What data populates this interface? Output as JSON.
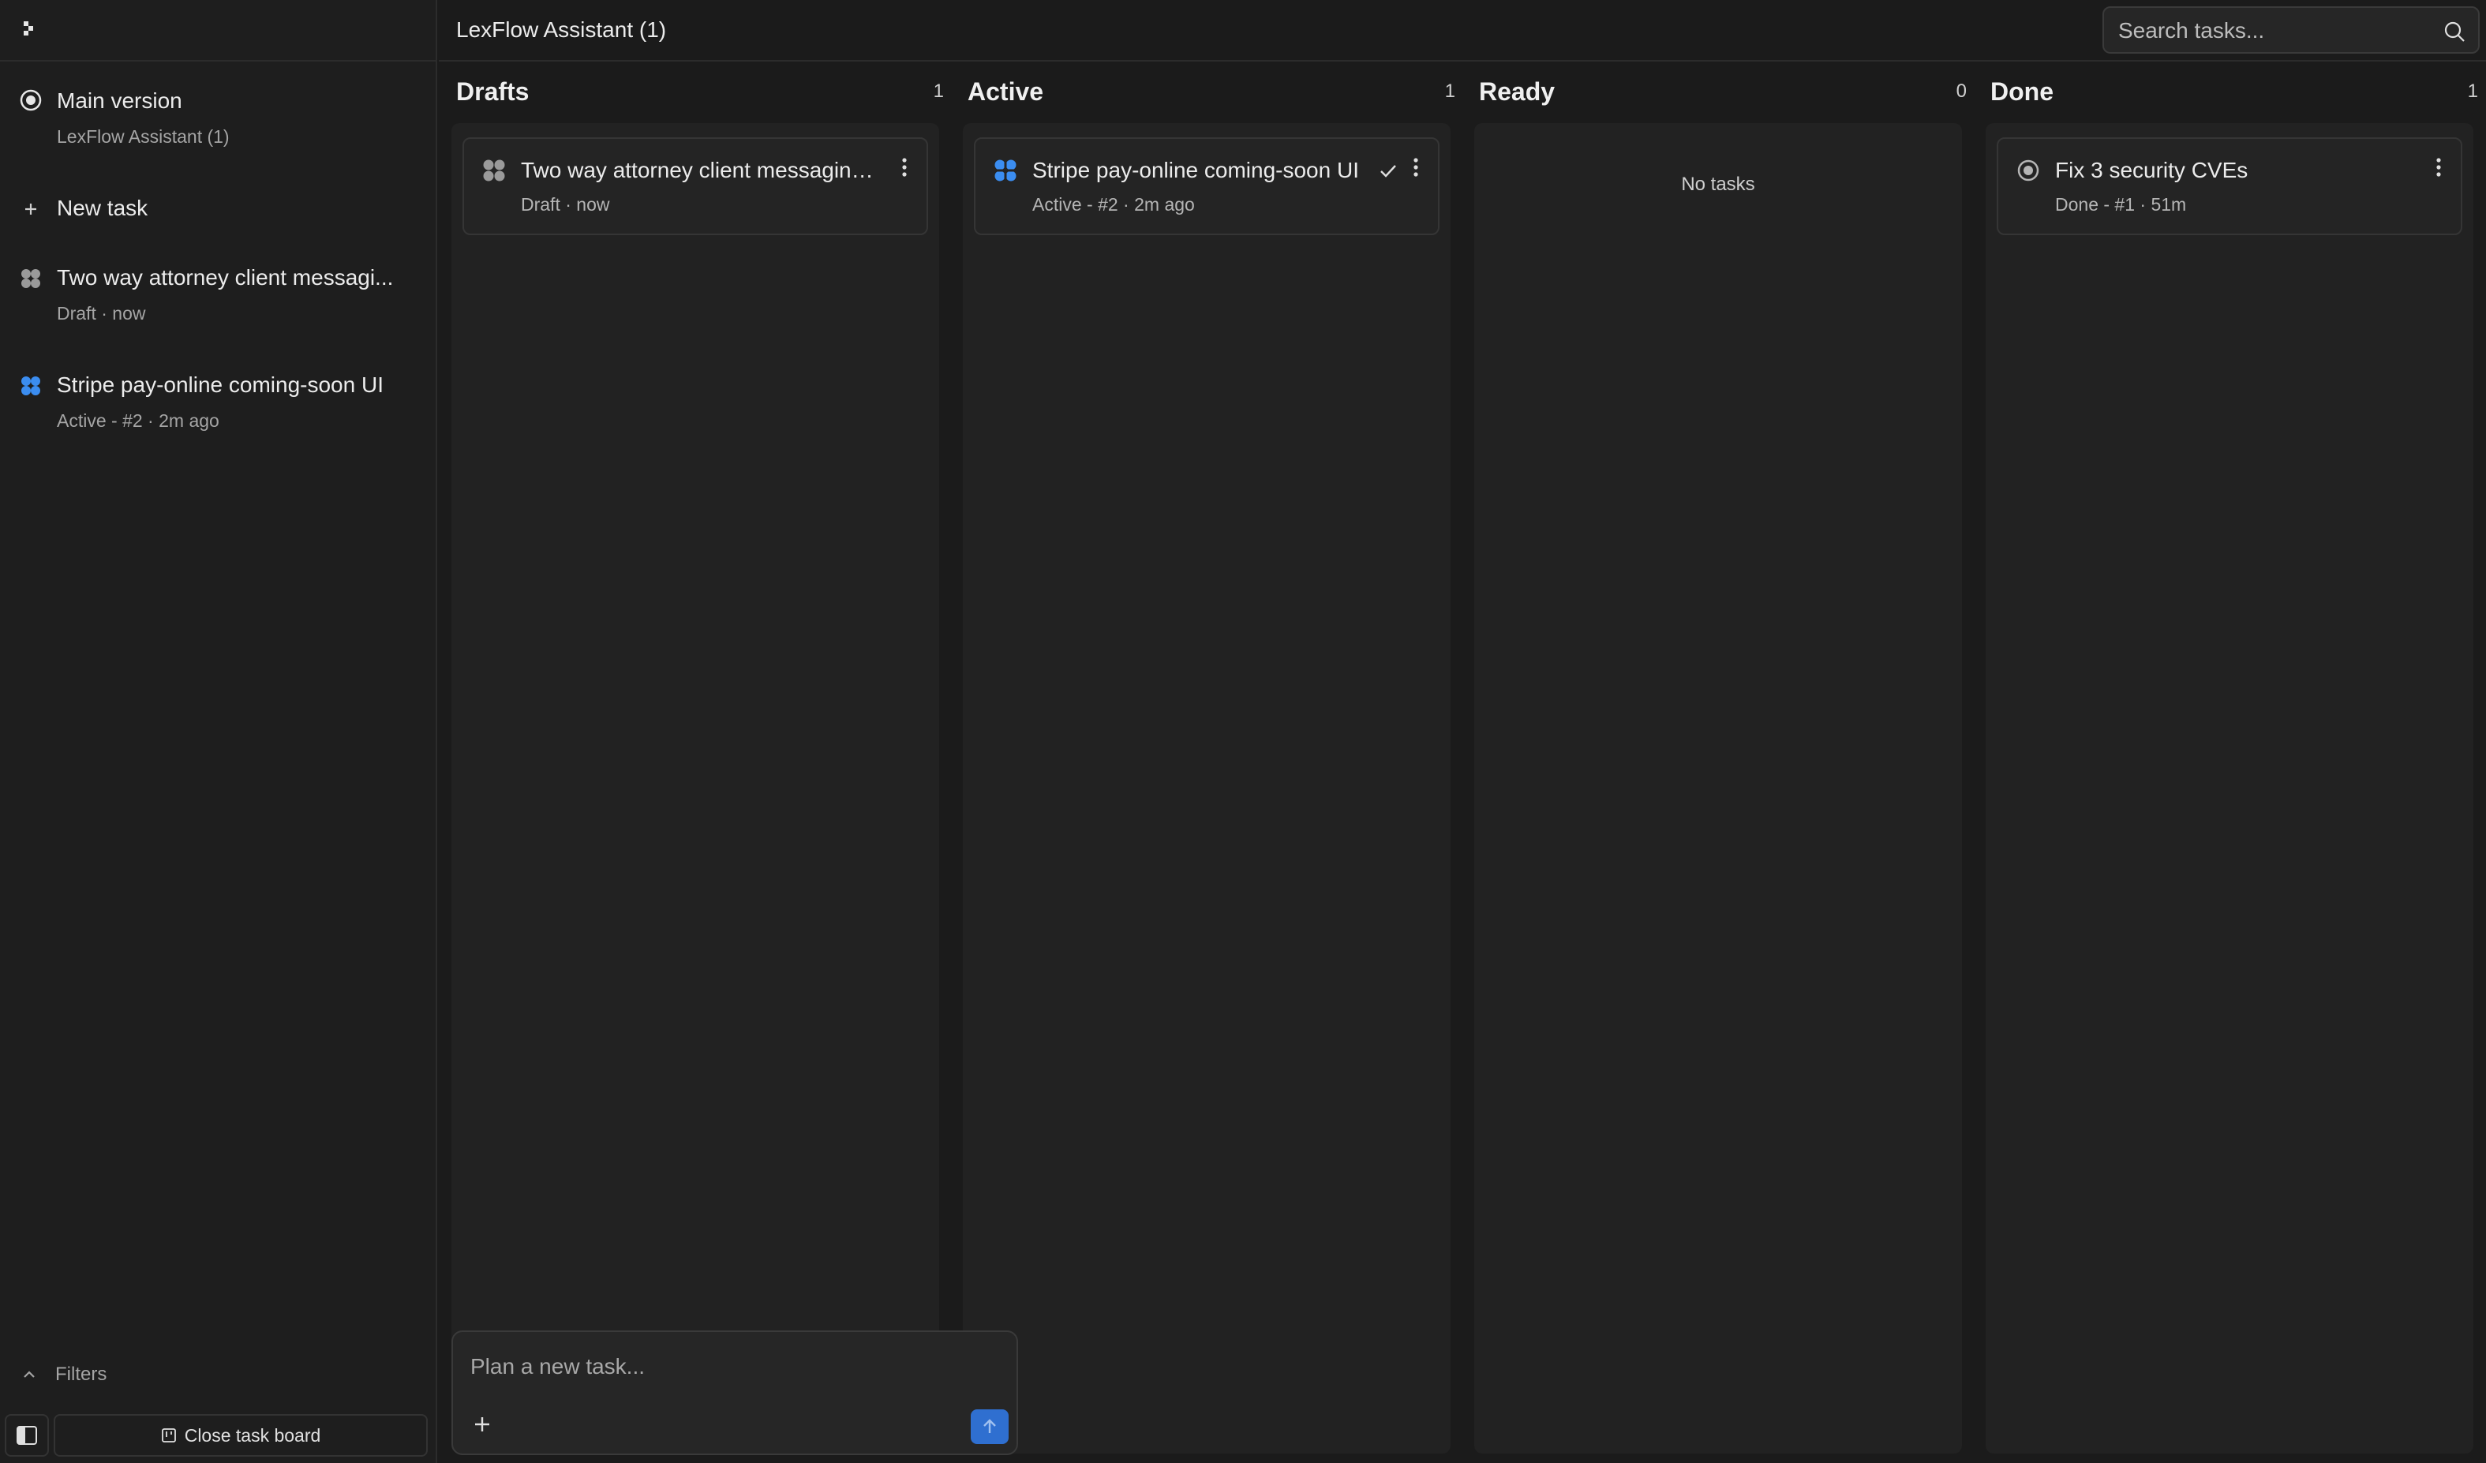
{
  "app": {
    "title": "LexFlow Assistant (1)"
  },
  "search": {
    "placeholder": "Search tasks..."
  },
  "sidebar": {
    "main": {
      "title": "Main version",
      "subtitle": "LexFlow Assistant (1)"
    },
    "new_task_label": "New task",
    "tasks": [
      {
        "title": "Two way attorney client messagi...",
        "status": "Draft",
        "time": "now",
        "icon": "grid-dots-icon",
        "color": "#9a9a9a"
      },
      {
        "title": "Stripe pay-online coming-soon UI",
        "status": "Active - #2",
        "time": "2m ago",
        "icon": "grid-dots-icon",
        "color": "#3b8df0"
      }
    ],
    "filters_label": "Filters",
    "close_board_label": "Close task board"
  },
  "columns": [
    {
      "title": "Drafts",
      "count": "1",
      "cards": [
        {
          "title": "Two way attorney client messaging ...",
          "status": "Draft",
          "time": "now",
          "icon": "grid-dots-icon",
          "color": "#9a9a9a"
        }
      ]
    },
    {
      "title": "Active",
      "count": "1",
      "cards": [
        {
          "title": "Stripe pay-online coming-soon UI",
          "status": "Active - #2",
          "time": "2m ago",
          "icon": "pinwheel-icon",
          "color": "#3b8df0",
          "checked": true
        }
      ]
    },
    {
      "title": "Ready",
      "count": "0",
      "empty_label": "No tasks",
      "cards": []
    },
    {
      "title": "Done",
      "count": "1",
      "cards": [
        {
          "title": "Fix 3 security CVEs",
          "status": "Done - #1",
          "time": "51m",
          "icon": "radio-target-icon",
          "color": "#b5b5b5"
        }
      ]
    }
  ],
  "composer": {
    "placeholder": "Plan a new task..."
  },
  "colors": {
    "accent": "#2f6fd0",
    "background": "#1b1b1b",
    "column": "#222222"
  }
}
